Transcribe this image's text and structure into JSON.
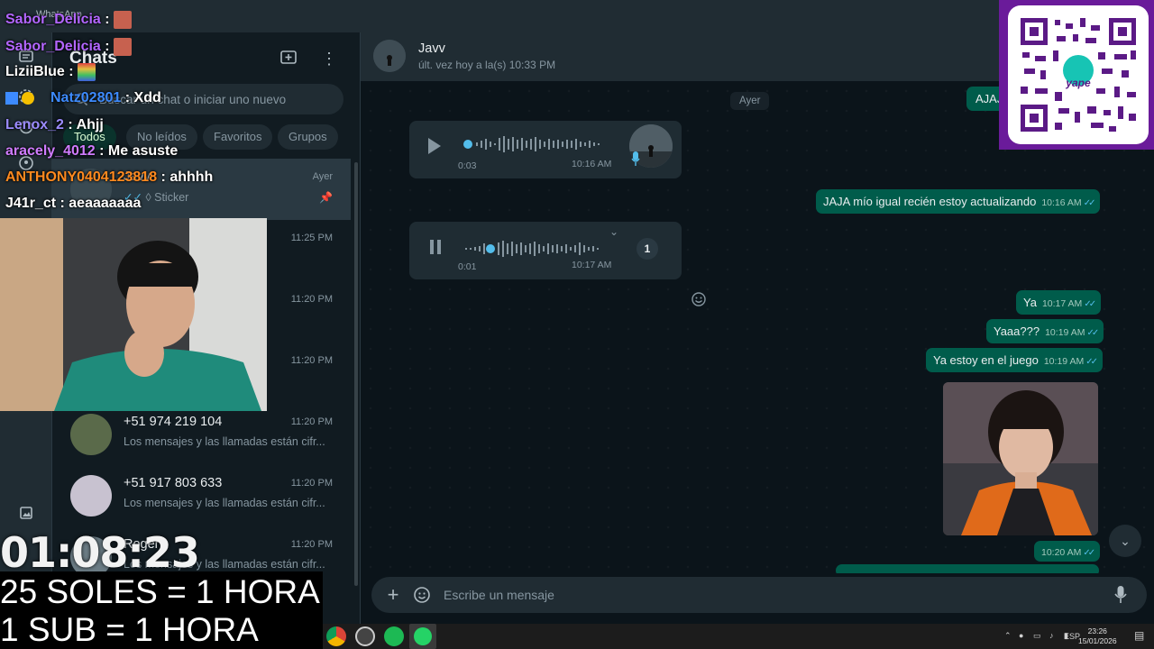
{
  "window": {
    "title": "WhatsApp"
  },
  "sidebar": {
    "title": "Chats",
    "search_placeholder": "Buscar un chat o iniciar uno nuevo",
    "filters": [
      "Todos",
      "No leídos",
      "Favoritos",
      "Grupos"
    ],
    "active_filter": "Todos",
    "chats": [
      {
        "name": "Javv",
        "time": "Ayer",
        "preview": "Sticker",
        "pinned": true,
        "selected": true
      },
      {
        "name": "",
        "time": "11:25 PM",
        "preview": "to",
        "pinned": false,
        "selected": false
      },
      {
        "name": "",
        "time": "11:20 PM",
        "preview": "están cifr...",
        "pinned": false,
        "selected": false
      },
      {
        "name": "",
        "time": "11:20 PM",
        "preview": "están cifr...",
        "pinned": false,
        "selected": false
      },
      {
        "name": "+51 974 219 104",
        "time": "11:20 PM",
        "preview": "Los mensajes y las llamadas están cifr...",
        "pinned": false,
        "selected": false
      },
      {
        "name": "+51 917 803 633",
        "time": "11:20 PM",
        "preview": "Los mensajes y las llamadas están cifr...",
        "pinned": false,
        "selected": false
      },
      {
        "name": "Roger",
        "time": "11:20 PM",
        "preview": "Los mensajes y las llamadas están cifr...",
        "pinned": false,
        "selected": false
      }
    ]
  },
  "conversation": {
    "contact_name": "Javv",
    "status": "últ. vez hoy a la(s) 10:33 PM",
    "day_badge": "Ayer",
    "top_partial_text": "AJAJ",
    "audio_messages": [
      {
        "duration": "0:03",
        "time": "10:16 AM",
        "progress": 0.0
      },
      {
        "duration": "0:01",
        "time": "10:17 AM",
        "progress": 0.18,
        "speed": "1"
      }
    ],
    "outgoing": [
      {
        "text": "JAJA mío igual recién estoy actualizando",
        "time": "10:16 AM"
      },
      {
        "text": "Ya",
        "time": "10:17 AM"
      },
      {
        "text": "Yaaa???",
        "time": "10:19 AM"
      },
      {
        "text": "Ya estoy en el juego",
        "time": "10:19 AM"
      }
    ],
    "sticker_time": "10:20 AM",
    "composer_placeholder": "Escribe un mensaje"
  },
  "stream": {
    "chat": [
      {
        "user": "Sabor_Delicia",
        "sep": " :",
        "msg": "",
        "color": "#b366ff",
        "emote": "#c7614f"
      },
      {
        "user": "Sabor_Delicia",
        "sep": " :",
        "msg": "",
        "color": "#b366ff",
        "emote": "#c7614f"
      },
      {
        "user": "LiziiBlue",
        "sep": " :",
        "msg": "",
        "color": "#ffffff",
        "emote": "#e060c0"
      },
      {
        "user": "Natz02801",
        "sep": " :",
        "msg": "Xdd",
        "color": "#3d8bff",
        "emote": ""
      },
      {
        "user": "Lenox_2",
        "sep": " :",
        "msg": "Ahjj",
        "color": "#9c8cff",
        "emote": ""
      },
      {
        "user": "aracely_4012",
        "sep": " :",
        "msg": "Me asuste",
        "color": "#d07cff",
        "emote": ""
      },
      {
        "user": "ANTHONY0404123818",
        "sep": " :",
        "msg": "ahhhh",
        "color": "#ff8a1f",
        "emote": ""
      },
      {
        "user": "J41r_ct",
        "sep": " :",
        "msg": "aeaaaaaaa",
        "color": "#ffffff",
        "emote": ""
      }
    ],
    "timer": "01:08:23",
    "banner_line1": "25 SOLES = 1 HORA",
    "banner_line2": "1 SUB = 1 HORA",
    "qr_brand": "yape"
  },
  "taskbar": {
    "lang": "ESP",
    "time": "23:26",
    "date": "15/01/2026"
  }
}
